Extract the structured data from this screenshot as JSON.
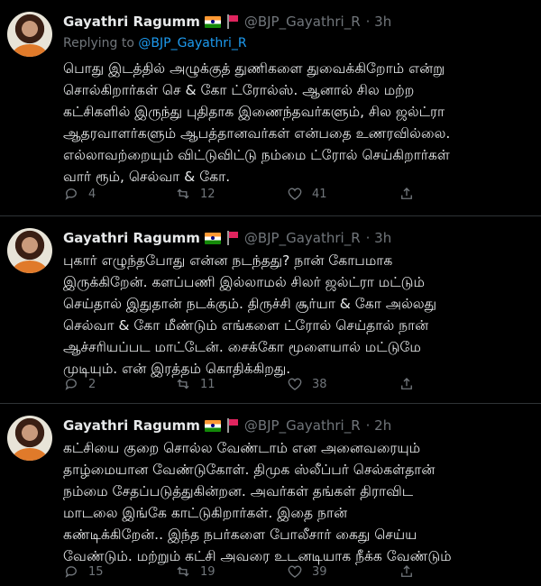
{
  "tweets": [
    {
      "name": "Gayathri Ragumm",
      "handle": "@BJP_Gayathri_R",
      "time": "· 3h",
      "replying_prefix": "Replying to",
      "replying_to": "@BJP_Gayathri_R",
      "lines": [
        "பொது இடத்தில் அழுக்குத் துணிகளை துவைக்கிறோம் என்று",
        "சொல்கிறார்கள் செ & கோ ட்ரோல்ஸ். ஆனால் சில மற்ற",
        "கட்சிகளில் இருந்து புதிதாக இணைந்தவர்களும், சில ஜல்ட்ரா",
        "ஆதரவாளர்களும் ஆபத்தானவர்கள் என்பதை உணரவில்லை.",
        "எல்லாவற்றையும் விட்டுவிட்டு நம்மை ட்ரோல் செய்கிறார்கள்",
        "வார் ரூம், செல்வா & கோ."
      ],
      "reply_count": "4",
      "retweet_count": "12",
      "like_count": "41"
    },
    {
      "name": "Gayathri Ragumm",
      "handle": "@BJP_Gayathri_R",
      "time": "· 3h",
      "lines": [
        "புகார் எழுந்தபோது என்ன நடந்தது? நான் கோபமாக",
        "இருக்கிறேன். களப்பணி இல்லாமல் சிலர் ஜல்ட்ரா மட்டும்",
        "செய்தால் இதுதான் நடக்கும். திருச்சி சூர்யா & கோ அல்லது",
        "செல்வா & கோ மீண்டும் எங்களை ட்ரோல் செய்தால் நான்",
        "ஆச்சரியப்பட மாட்டேன். சைக்கோ மூளையால் மட்டுமே",
        "முடியும். என் இரத்தம் கொதிக்கிறது."
      ],
      "reply_count": "2",
      "retweet_count": "11",
      "like_count": "38"
    },
    {
      "name": "Gayathri Ragumm",
      "handle": "@BJP_Gayathri_R",
      "time": "· 2h",
      "lines": [
        "கட்சியை குறை சொல்ல வேண்டாம் என அனைவரையும்",
        "தாழ்மையான வேண்டுகோள். திமுக ஸ்லீப்பர் செல்கள்தான்",
        "நம்மை சேதப்படுத்துகின்றன. அவர்கள் தங்கள் திராவிட",
        "மாடலை இங்கே காட்டுகிறார்கள். இதை நான்",
        "கண்டிக்கிறேன்.. இந்த நபர்களை போலீசார் கைது செய்ய",
        "வேண்டும். மற்றும் கட்சி அவரை உடனடியாக நீக்க வேண்டும்"
      ],
      "reply_count": "15",
      "retweet_count": "19",
      "like_count": "39"
    }
  ],
  "colors": {
    "background": "#000000",
    "text": "#e7e9ea",
    "muted": "#71767b",
    "link": "#1d9bf0"
  },
  "icons": [
    "reply-icon",
    "retweet-icon",
    "like-icon",
    "share-icon"
  ]
}
